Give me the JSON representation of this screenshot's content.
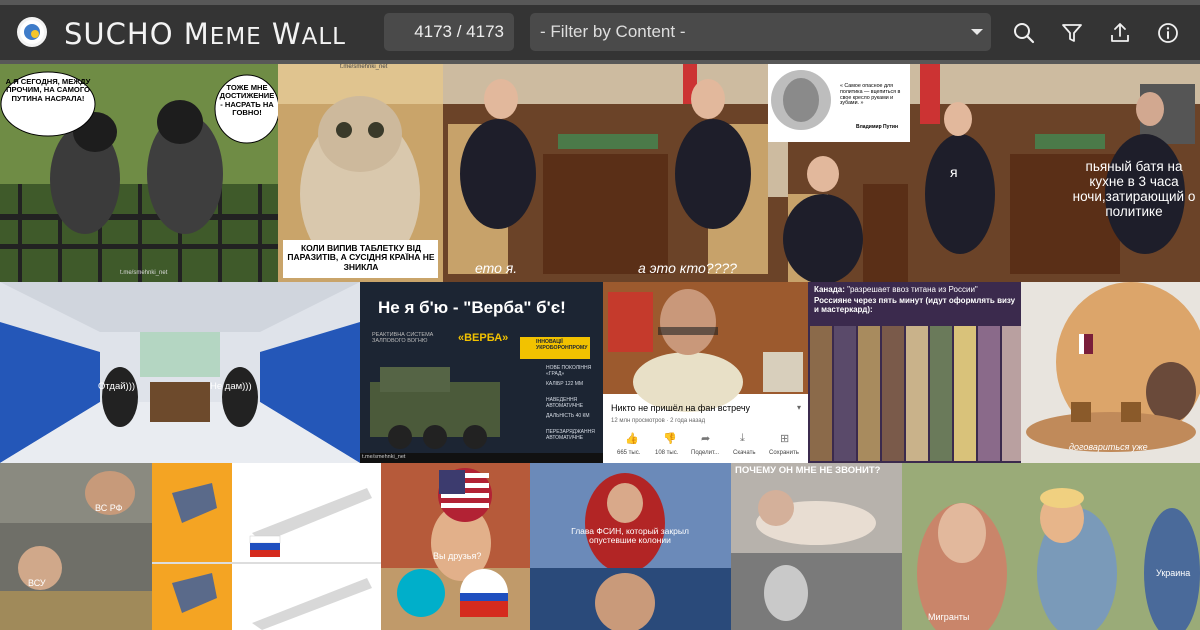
{
  "header": {
    "title_s": "SUCHO",
    "title_meme_m": "M",
    "title_meme_rest": "EME",
    "title_wall_w": "W",
    "title_wall_rest": "ALL",
    "counter": "4173 / 4173",
    "filter_placeholder": "- Filter by Content -"
  },
  "icons": [
    "search-icon",
    "filter-icon",
    "share-icon",
    "info-icon"
  ],
  "memes": {
    "crows": {
      "left_bubble": "А Я СЕГОДНЯ, МЕЖДУ ПРОЧИМ, НА САМОГО ПУТИНА НАСРАЛА!",
      "right_bubble": "ТОЖЕ МНЕ ДОСТИЖЕНИЕ - НАСРАТЬ НА ГОВНО!",
      "watermark": "t.me/smehnki_net"
    },
    "cat": {
      "watermark": "t.me/smehnki_net",
      "caption": "КОЛИ ВИПИВ ТАБЛЕТКУ ВІД ПАРАЗИТІВ, А СУСІДНЯ КРАЇНА НЕ ЗНИКЛА"
    },
    "meeting": {
      "left": "ето я.",
      "right": "а это кто????"
    },
    "quote": {
      "text": "« Самое опасное для политика — вцепиться в свое кресло руками и зубами. »",
      "author": "Владимир Путин"
    },
    "drunk": {
      "left": "я",
      "right": "пьяный батя на кухне в 3 часа ночи,затирающий о политике"
    },
    "train": {
      "left": "Отдай)))",
      "right": "Не дам)))",
      "watermark": "t.me/smehnki_net"
    },
    "verba": {
      "title": "Не я б'ю - \"Верба\" б'є!",
      "sub": "РЕАКТИВНА СИСТЕМА ЗАЛПОВОГО ВОГНЮ",
      "name": "«ВЕРБА»",
      "badge": "ІННОВАЦІЇ УКРОБОРОНПРОМУ",
      "specs": [
        "НОВЕ ПОКОЛІННЯ «ГРАД»",
        "КАЛІБР 122 ММ",
        "НАВЕДЕННЯ АВТОМАТИЧНЕ",
        "ДАЛЬНІСТЬ 40 КМ",
        "ПЕРЕЗАРЯДЖАННЯ АВТОМАТИЧНЕ"
      ]
    },
    "youtube": {
      "title": "Никто не пришёл на фан встречу",
      "meta": "12 млн просмотров · 2 года назад",
      "likes": "665 тыс.",
      "dislikes": "108 тыс.",
      "share": "Поделит...",
      "download": "Скачать",
      "save": "Сохранить"
    },
    "anime": {
      "canada_label": "Канада:",
      "canada_text": "\"разрешает ввоз титана из России\"",
      "russians": "Россияне через пять минут (идут оформлять визу и мастеркард):"
    },
    "dog": {
      "caption": "договариться уже"
    },
    "cars": {
      "top": "ВС РФ",
      "bottom": "ВСУ"
    },
    "flash": {
      "caption": "Глава ФСИН, который закрыл опустевшие колонии"
    },
    "friends": {
      "caption": "Вы друзья?"
    },
    "call": {
      "caption": "ПОЧЕМУ ОН МНЕ НЕ ЗВОНИТ?"
    },
    "distracted": {
      "left": "Мигранты",
      "right": "Украина"
    }
  }
}
